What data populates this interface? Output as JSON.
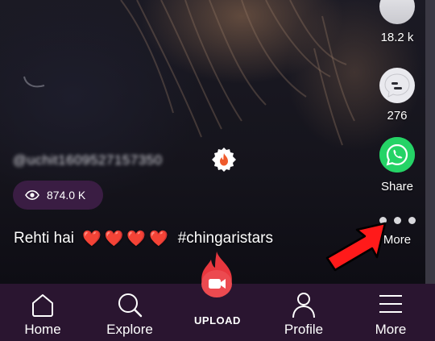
{
  "video": {
    "username": "@uchit1609527157350",
    "views": "874.0 K",
    "caption_prefix": "Rehti hai",
    "caption_hearts": [
      "❤️",
      "❤️",
      "❤️",
      "❤️"
    ],
    "caption_hashtag": "#chingaristars"
  },
  "side_actions": {
    "like_count": "18.2 k",
    "comment_count": "276",
    "share_label": "Share",
    "more_label": "More"
  },
  "nav": {
    "home": "Home",
    "explore": "Explore",
    "upload": "UPLOAD",
    "profile": "Profile",
    "more": "More"
  },
  "colors": {
    "nav_bg": "#2a1530",
    "views_pill_bg": "#3a1d43",
    "whatsapp_green": "#25d366",
    "upload_red": "#e8373e",
    "annotation_arrow": "#ff1a1a"
  },
  "icons": {
    "like": "like-icon",
    "comment": "comment-icon",
    "share": "whatsapp-icon",
    "more": "three-dots-icon",
    "views": "eye-icon",
    "badge": "chingari-flame-badge-icon",
    "home": "home-icon",
    "explore": "search-icon",
    "upload": "flame-camera-icon",
    "profile": "person-icon",
    "menu": "hamburger-icon"
  }
}
